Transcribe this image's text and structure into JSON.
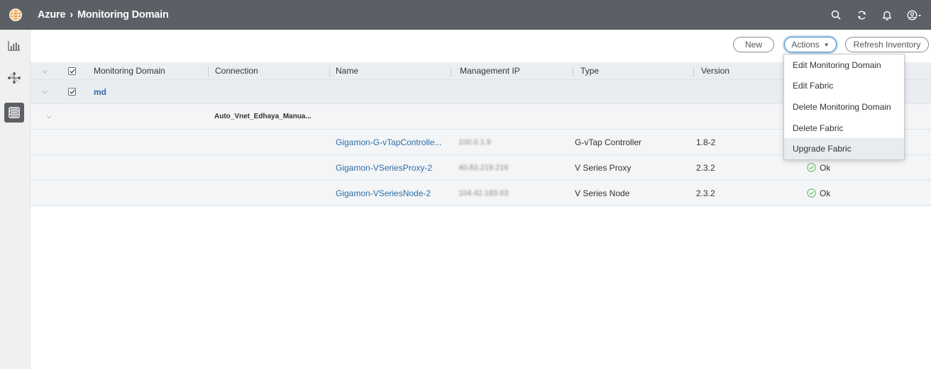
{
  "breadcrumb": {
    "parent": "Azure",
    "separator": "›",
    "current": "Monitoring Domain"
  },
  "top_icons": [
    "search-icon",
    "refresh-icon",
    "bell-icon",
    "user-icon"
  ],
  "rail_icons": [
    "dashboard-icon",
    "topology-icon",
    "inventory-icon"
  ],
  "toolbar": {
    "new_label": "New",
    "actions_label": "Actions",
    "refresh_label": "Refresh Inventory"
  },
  "table": {
    "headers": {
      "monitoring_domain": "Monitoring Domain",
      "connection": "Connection",
      "name": "Name",
      "management_ip": "Management IP",
      "type": "Type",
      "version": "Version"
    },
    "group": {
      "name": "md",
      "connection": "Auto_Vnet_Edhaya_Manua..."
    },
    "rows": [
      {
        "name": "Gigamon-G-vTapControlle...",
        "ip": "100.0.1.9",
        "type": "G-vTap Controller",
        "version": "1.8-2",
        "status": ""
      },
      {
        "name": "Gigamon-VSeriesProxy-2",
        "ip": "40.83.219.216",
        "type": "V Series Proxy",
        "version": "2.3.2",
        "status": "Ok"
      },
      {
        "name": "Gigamon-VSeriesNode-2",
        "ip": "104.42.183.63",
        "type": "V Series Node",
        "version": "2.3.2",
        "status": "Ok"
      }
    ]
  },
  "actions_menu": [
    "Edit Monitoring Domain",
    "Edit Fabric",
    "Delete Monitoring Domain",
    "Delete Fabric",
    "Upgrade Fabric"
  ],
  "colors": {
    "topbar": "#5c5f66",
    "link": "#2f6ea8",
    "ok": "#5cb85c",
    "accent": "#4c8fc4"
  }
}
